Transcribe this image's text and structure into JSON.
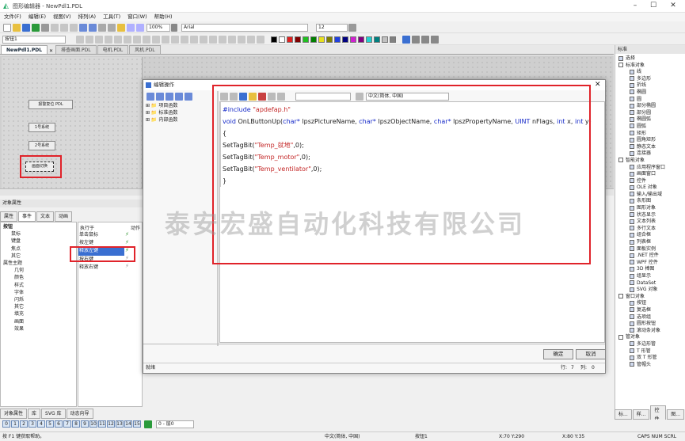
{
  "window": {
    "title": "图形编辑器 - NewPdl1.PDL"
  },
  "menu": [
    "文件(F)",
    "编辑(E)",
    "视图(V)",
    "排列(A)",
    "工具(T)",
    "窗口(W)",
    "帮助(H)"
  ],
  "toolbar": {
    "zoom": "100%",
    "font": "Arial",
    "font_size": "12",
    "object_select": "按钮1"
  },
  "doc_tabs": [
    "NewPdl1.PDL",
    "排查画面.PDL",
    "电机.PDL",
    "风机.PDL"
  ],
  "canvas": {
    "buttons": [
      "报警复位 PDL",
      "1号系统",
      "2号系统",
      "画面切换"
    ]
  },
  "props": {
    "title": "对象属性",
    "tabs": [
      "属性",
      "事件",
      "文本",
      "动画"
    ],
    "tree": [
      "按钮",
      "鼠标",
      "键盘",
      "焦点",
      "其它",
      "属性主题",
      "几何",
      "颜色",
      "样式",
      "字体",
      "闪烁",
      "其它",
      "填充",
      "画面",
      "效果"
    ],
    "event_header": [
      "执行于",
      "动作"
    ],
    "events": [
      "单击鼠标",
      "按左键",
      "释放左键",
      "按右键",
      "释放右键"
    ]
  },
  "bottom_tabs": [
    "对象属性",
    "库",
    "SVG 库",
    "动态向导"
  ],
  "pages": [
    "0",
    "1",
    "2",
    "3",
    "4",
    "5",
    "6",
    "7",
    "8",
    "9",
    "10",
    "11",
    "12",
    "13",
    "14",
    "15"
  ],
  "layer_select": "0 - 层0",
  "status": {
    "help": "按 F1 键获取帮助。",
    "lang": "中文(简体, 中国)",
    "object": "按钮1",
    "pos": "X:70 Y:290",
    "size": "X:80 Y:35",
    "keys": "CAPS NUM SCRL"
  },
  "right_panel": {
    "title": "标准",
    "items": [
      "选择",
      "标准对象",
      "线",
      "多边形",
      "折线",
      "椭圆",
      "圆",
      "部分椭圆",
      "部分圆",
      "椭圆弧",
      "圆弧",
      "矩形",
      "圆角矩形",
      "静态文本",
      "连接器",
      "智能对象",
      "应用程序窗口",
      "画面窗口",
      "控件",
      "OLE 对象",
      "输入/输出域",
      "条形图",
      "图形对象",
      "状态显示",
      "文本列表",
      "多行文本",
      "组合框",
      "列表框",
      "面板实例",
      ".NET 控件",
      "WPF 控件",
      "3D 棒图",
      "组显示",
      "DataSet",
      "SVG 对象",
      "窗口对象",
      "按钮",
      "复选框",
      "选项组",
      "圆形按钮",
      "滚动条对象",
      "管对象",
      "多边形管",
      "T 形管",
      "双 T 形管",
      "管帽头"
    ],
    "bottom_tabs": [
      "标...",
      "样...",
      "控件",
      "图..."
    ]
  },
  "dialog": {
    "title": "编辑操作",
    "tree": [
      "项目函数",
      "标准函数",
      "内部函数"
    ],
    "language": "中文(简体, 中国)",
    "code": [
      "#include \"apdefap.h\"",
      "void OnLButtonUp(char* lpszPictureName, char* lpszObjectName, char* lpszPropertyName, UINT nFlags, int x, int y)",
      "{",
      "SetTagBit(\"Temp_就地\",0);",
      "SetTagBit(\"Temp_motor\",0);",
      "SetTagBit(\"Temp_ventilator\",0);",
      "}"
    ],
    "ok": "确定",
    "cancel": "取消",
    "status_left": "就绪",
    "line_label": "行:",
    "line_val": "7",
    "col_label": "列:",
    "col_val": "0"
  },
  "watermark": "泰安宏盛自动化科技有限公司",
  "colors": {
    "highlight": "#e0232a",
    "selection": "#3a6fd1",
    "keyword": "#1428c8",
    "string": "#c42828"
  }
}
